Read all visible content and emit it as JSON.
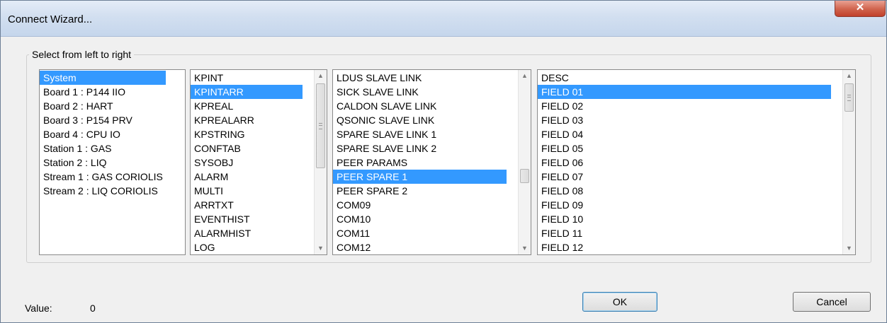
{
  "window": {
    "title": "Connect Wizard...",
    "close_label": "✕"
  },
  "group": {
    "label": "Select from left to right"
  },
  "lists": [
    {
      "items": [
        "System",
        "Board 1 : P144 IIO",
        "Board 2 : HART",
        "Board 3 : P154 PRV",
        "Board 4 : CPU IO",
        "Station 1 : GAS",
        "Station 2 : LIQ",
        "Stream 1 : GAS CORIOLIS",
        "Stream 2 : LIQ CORIOLIS"
      ],
      "selected": "System"
    },
    {
      "items": [
        "KPINT",
        "KPINTARR",
        "KPREAL",
        "KPREALARR",
        "KPSTRING",
        "CONFTAB",
        "SYSOBJ",
        "ALARM",
        "MULTI",
        "ARRTXT",
        "EVENTHIST",
        "ALARMHIST",
        "LOG"
      ],
      "selected": "KPINTARR"
    },
    {
      "items": [
        "LDUS SLAVE LINK",
        "SICK SLAVE LINK",
        "CALDON SLAVE LINK",
        "QSONIC SLAVE LINK",
        "SPARE SLAVE LINK 1",
        "SPARE SLAVE LINK 2",
        "PEER PARAMS",
        "PEER SPARE 1",
        "PEER SPARE 2",
        "COM09",
        "COM10",
        "COM11",
        "COM12"
      ],
      "selected": "PEER SPARE 1"
    },
    {
      "items": [
        "DESC",
        "FIELD 01",
        "FIELD 02",
        "FIELD 03",
        "FIELD 04",
        "FIELD 05",
        "FIELD 06",
        "FIELD 07",
        "FIELD 08",
        "FIELD 09",
        "FIELD 10",
        "FIELD 11",
        "FIELD 12"
      ],
      "selected": "FIELD 01"
    }
  ],
  "footer": {
    "value_label": "Value:",
    "value": "0",
    "ok_label": "OK",
    "cancel_label": "Cancel"
  },
  "icons": {
    "scroll_up": "scroll-up-arrow",
    "scroll_down": "scroll-down-arrow",
    "close": "close-icon"
  }
}
